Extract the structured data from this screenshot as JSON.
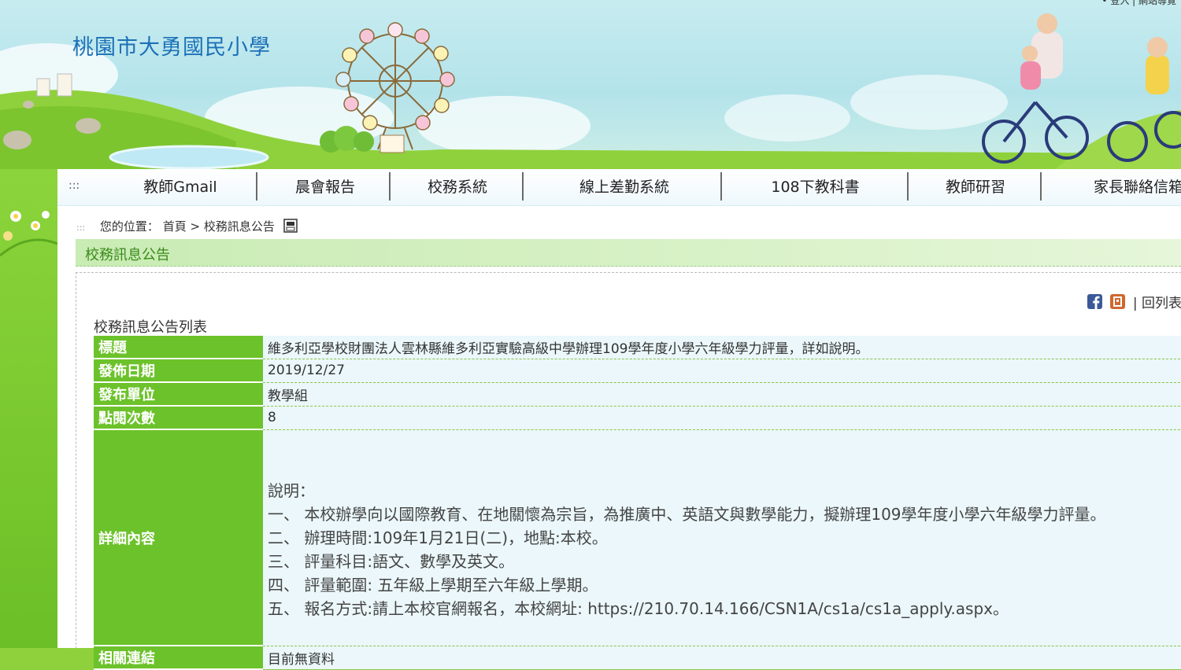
{
  "header": {
    "school_name": "桃園市大勇國民小學",
    "top_links": "• 登入 | 網站導覽"
  },
  "nav": {
    "items": [
      {
        "label": "教師Gmail"
      },
      {
        "label": "晨會報告"
      },
      {
        "label": "校務系統"
      },
      {
        "label": "線上差勤系統"
      },
      {
        "label": "108下教科書"
      },
      {
        "label": "教師研習"
      },
      {
        "label": "家長聯絡信箱"
      }
    ]
  },
  "breadcrumb": {
    "prefix": "您的位置：",
    "home": "首頁",
    "separator": " > ",
    "current": "校務訊息公告"
  },
  "section": {
    "title": "校務訊息公告",
    "back_link": "| 回列表",
    "list_caption": "校務訊息公告列表"
  },
  "detail": {
    "title_label": "標題",
    "title_value": "維多利亞學校財團法人雲林縣維多利亞實驗高級中學辦理109學年度小學六年級學力評量，詳如說明。",
    "date_label": "發佈日期",
    "date_value": "2019/12/27",
    "unit_label": "發布單位",
    "unit_value": "教學組",
    "views_label": "點閱次數",
    "views_value": "8",
    "content_label": "詳細內容",
    "content_lines": [
      "說明：",
      "一、 本校辦學向以國際教育、在地關懷為宗旨，為推廣中、英語文與數學能力，擬辦理109學年度小學六年級學力評量。",
      "二、 辦理時間:109年1月21日(二)，地點:本校。",
      "三、 評量科目:語文、數學及英文。",
      "四、 評量範圍: 五年級上學期至六年級上學期。",
      "五、 報名方式:請上本校官網報名，本校網址: https://210.70.14.166/CSN1A/cs1a/cs1a_apply.aspx。"
    ],
    "links_label": "相關連結",
    "links_value": "目前無資料"
  },
  "colors": {
    "label_bg": "#6cc22a",
    "value_bg": "#ebf7fa",
    "title_blue": "#1d71b8",
    "section_green": "#3a8a19"
  },
  "icons": [
    "print-icon",
    "facebook-icon",
    "plurk-icon",
    "ferris-wheel-icon"
  ]
}
